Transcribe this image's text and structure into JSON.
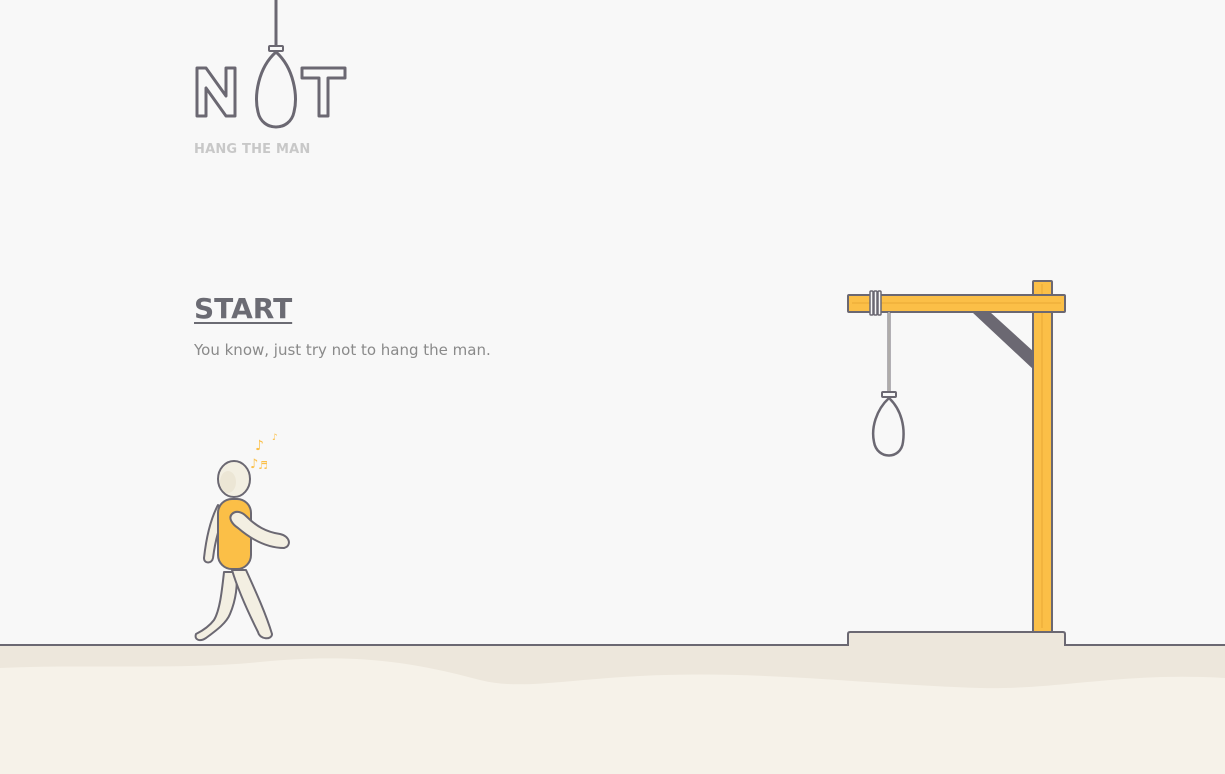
{
  "logo": {
    "letters": [
      "N",
      "T"
    ],
    "tagline": "HANG THE MAN"
  },
  "menu": {
    "start_label": "START",
    "subtitle": "You know, just try not to hang the man."
  },
  "colors": {
    "background": "#f8f8f8",
    "ground": "#f6f2e9",
    "ground_shade": "#ede7dc",
    "outline": "#6b6872",
    "wood": "#fbbf47",
    "shirt": "#fbbf47",
    "skin": "#f3efe2",
    "notes": "#fbbf47",
    "muted_text": "#c8c8c8"
  },
  "icons": [
    "noose-icon",
    "music-notes-icon",
    "gallows-icon",
    "walking-man-icon"
  ]
}
